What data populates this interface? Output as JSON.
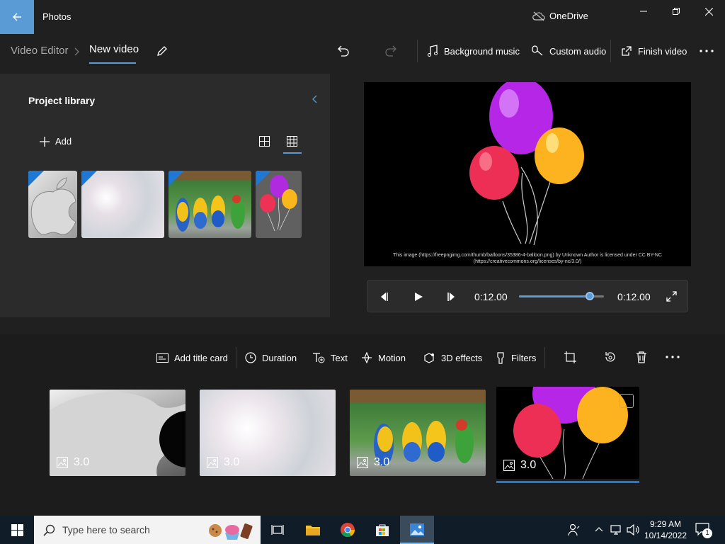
{
  "window": {
    "app_name": "Photos",
    "onedrive_label": "OneDrive"
  },
  "breadcrumb": {
    "root": "Video Editor",
    "current": "New video"
  },
  "commands": {
    "background_music": "Background music",
    "custom_audio": "Custom audio",
    "finish_video": "Finish video"
  },
  "library": {
    "title": "Project library",
    "add_label": "Add"
  },
  "preview": {
    "caption": "This image (https://freepngimg.com/thumb/balloons/35386-4-balloon.png) by Unknown Author is licensed under CC BY-NC (https://creativecommons.org/licenses/by-nc/3.0/)",
    "current_time": "0:12.00",
    "total_time": "0:12.00",
    "progress": 0.83
  },
  "storyboard": {
    "tools": {
      "add_title_card": "Add title card",
      "duration": "Duration",
      "text": "Text",
      "motion": "Motion",
      "effects_3d": "3D effects",
      "filters": "Filters"
    },
    "clips": [
      {
        "duration": "3.0"
      },
      {
        "duration": "3.0"
      },
      {
        "duration": "3.0"
      },
      {
        "duration": "3.0"
      }
    ]
  },
  "taskbar": {
    "search_placeholder": "Type here to search",
    "time": "9:29 AM",
    "date": "10/14/2022",
    "notification_count": "1"
  },
  "colors": {
    "accent": "#5b9bd5",
    "selection_blue": "#1e78d4",
    "window_bg": "#202020",
    "panel_bg": "#2b2b2b",
    "taskbar_bg": "#101c28"
  },
  "icons": [
    "back-arrow-icon",
    "cloud-offline-icon",
    "minimize-icon",
    "restore-icon",
    "close-icon",
    "pencil-icon",
    "undo-icon",
    "redo-icon",
    "music-note-icon",
    "microphone-icon",
    "share-icon",
    "more-icon",
    "chevron-left-icon",
    "plus-icon",
    "grid-small-icon",
    "grid-large-icon",
    "prev-frame-icon",
    "play-icon",
    "next-frame-icon",
    "fullscreen-icon",
    "title-card-icon",
    "clock-icon",
    "text-icon",
    "motion-icon",
    "effects-3d-icon",
    "filters-icon",
    "crop-icon",
    "rotate-icon",
    "delete-icon",
    "image-icon",
    "windows-icon",
    "search-icon",
    "task-view-icon",
    "folder-icon",
    "chrome-icon",
    "store-icon",
    "photos-icon",
    "people-icon",
    "chevron-up-icon",
    "network-icon",
    "volume-icon",
    "notification-icon"
  ]
}
